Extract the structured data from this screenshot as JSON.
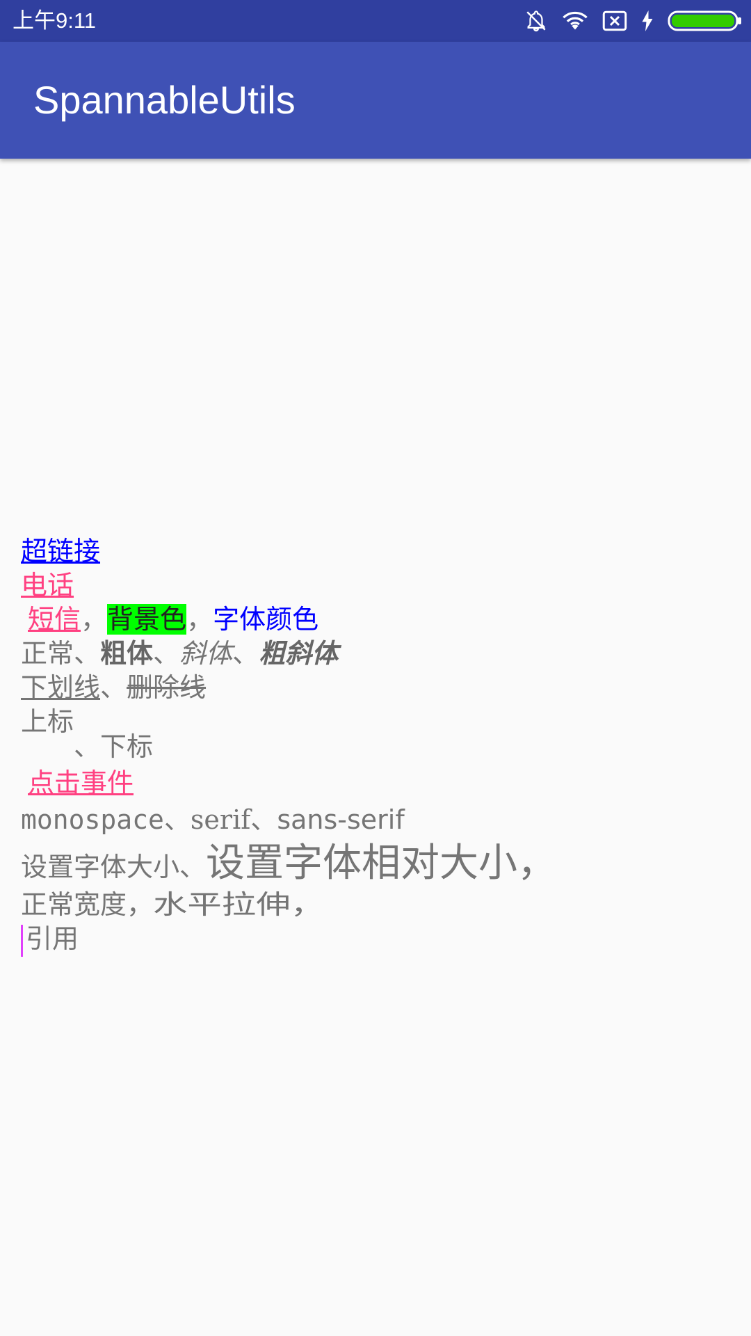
{
  "status_bar": {
    "time": "上午9:11",
    "icons": [
      "bell-off-icon",
      "wifi-icon",
      "sim-x-icon",
      "charging-icon",
      "battery-icon"
    ]
  },
  "app_bar": {
    "title": "SpannableUtils"
  },
  "content": {
    "hyperlink": "超链接",
    "phone": "电话",
    "sms": "短信",
    "comma1": "，",
    "background_color": "背景色",
    "comma2": "，",
    "font_color": "字体颜色",
    "normal": "正常、",
    "bold": "粗体",
    "sep1": "、",
    "italic": "斜体",
    "sep2": "、",
    "bold_italic": "粗斜体",
    "underline": "下划线",
    "sep3": "、",
    "strikethrough": "删除线",
    "superscript": "上标",
    "subscript_sep": "、",
    "subscript": "下标",
    "click_event": "点击事件",
    "font_mono": "monospace",
    "font_sep1": "、",
    "font_serif": "serif",
    "font_sep2": "、",
    "font_sans": "sans-serif",
    "font_size": "设置字体大小、",
    "relative_size": "设置字体相对大小，",
    "normal_width": "正常宽度，",
    "stretch": "水平拉伸，",
    "quote": "引用"
  },
  "colors": {
    "status_bar": "#303f9f",
    "app_bar": "#3f51b5",
    "link_blue": "#0000ff",
    "accent_pink": "#ff4081",
    "highlight_green": "#00ff00",
    "quote_bar": "#e040fb",
    "text_gray": "#757575",
    "battery_green": "#33cc00"
  }
}
